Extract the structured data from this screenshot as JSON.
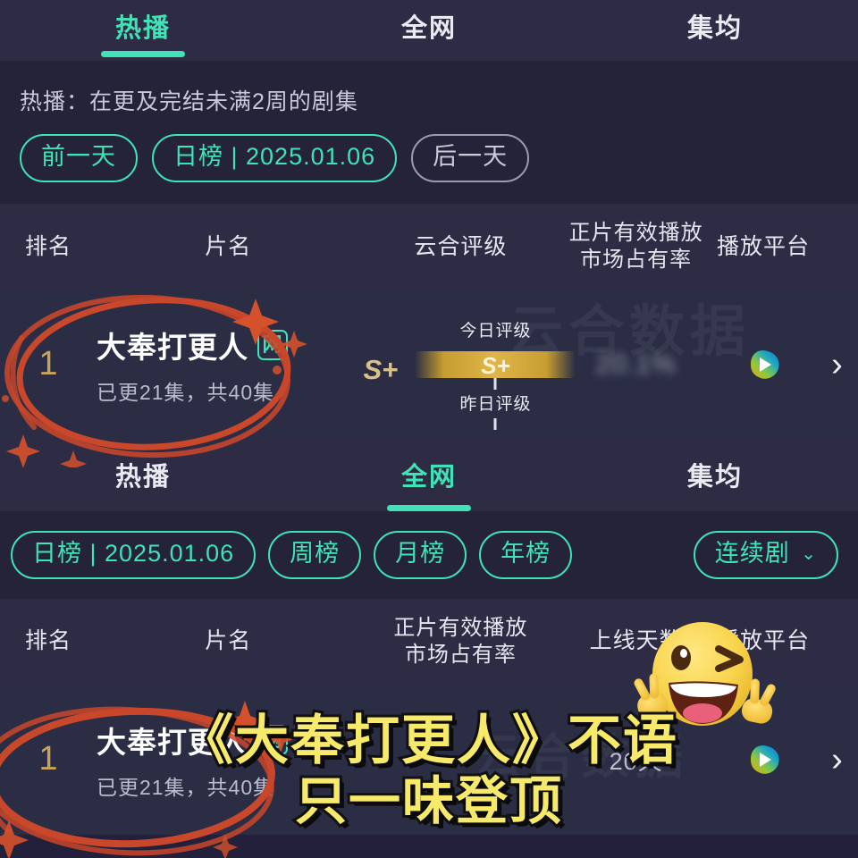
{
  "theme": {
    "accent_teal": "#3fe3b6",
    "gold": "#e0b54a",
    "rank_gold": "#c9a35a",
    "bg_dark": "#252339",
    "bg_tabbar": "#2e2c44",
    "bg_row": "#2a2d44",
    "annotation_red": "#c9472a",
    "caption_yellow": "#f7e96a"
  },
  "section_one": {
    "tabs": [
      {
        "label": "热播",
        "active": true
      },
      {
        "label": "全网",
        "active": false
      },
      {
        "label": "集均",
        "active": false
      }
    ],
    "subtitle": "热播：在更及完结未满2周的剧集",
    "pills": [
      {
        "label": "前一天",
        "style": "accent"
      },
      {
        "label": "日榜 | 2025.01.06",
        "style": "accent"
      },
      {
        "label": "后一天",
        "style": "muted"
      }
    ],
    "columns": {
      "rank": "排名",
      "title": "片名",
      "grade": "云合评级",
      "share_l1": "正片有效播放",
      "share_l2": "市场占有率",
      "platform": "播放平台"
    },
    "rows": [
      {
        "rank": "1",
        "title": "大奉打更人",
        "net_badge": "网",
        "subtitle": "已更21集，共40集",
        "grade_prev": "S+",
        "grade_today": "S+",
        "cap_today": "今日评级",
        "cap_yesterday": "昨日评级",
        "share": "20.1%",
        "platform_icon": "youku-logo",
        "arrow_icon": "chevron-right-icon"
      }
    ],
    "watermark": "云合数据"
  },
  "section_two": {
    "tabs": [
      {
        "label": "热播",
        "active": false
      },
      {
        "label": "全网",
        "active": true
      },
      {
        "label": "集均",
        "active": false
      }
    ],
    "pills": [
      {
        "label": "日榜 | 2025.01.06",
        "style": "accent"
      },
      {
        "label": "周榜",
        "style": "accent"
      },
      {
        "label": "月榜",
        "style": "accent"
      },
      {
        "label": "年榜",
        "style": "accent"
      }
    ],
    "filter": {
      "label": "连续剧",
      "chevron": "⌄"
    },
    "columns": {
      "rank": "排名",
      "title": "片名",
      "share_l1": "正片有效播放",
      "share_l2": "市场占有率",
      "days": "上线天数",
      "platform": "播放平台"
    },
    "rows": [
      {
        "rank": "1",
        "title": "大奉打更人",
        "net_badge": "网",
        "subtitle": "已更21集，共40集",
        "days": "20天",
        "platform_icon": "youku-logo",
        "arrow_icon": "chevron-right-icon"
      }
    ],
    "watermark": "云合数据"
  },
  "overlay": {
    "sticker_icon": "winking-face-peace-hands-emoji",
    "caption_line1": "《大奉打更人》不语",
    "caption_line2": "只一味登顶",
    "annotation_top_icon": "red-circle-scribble",
    "annotation_bottom_icon": "red-circle-scribble"
  }
}
